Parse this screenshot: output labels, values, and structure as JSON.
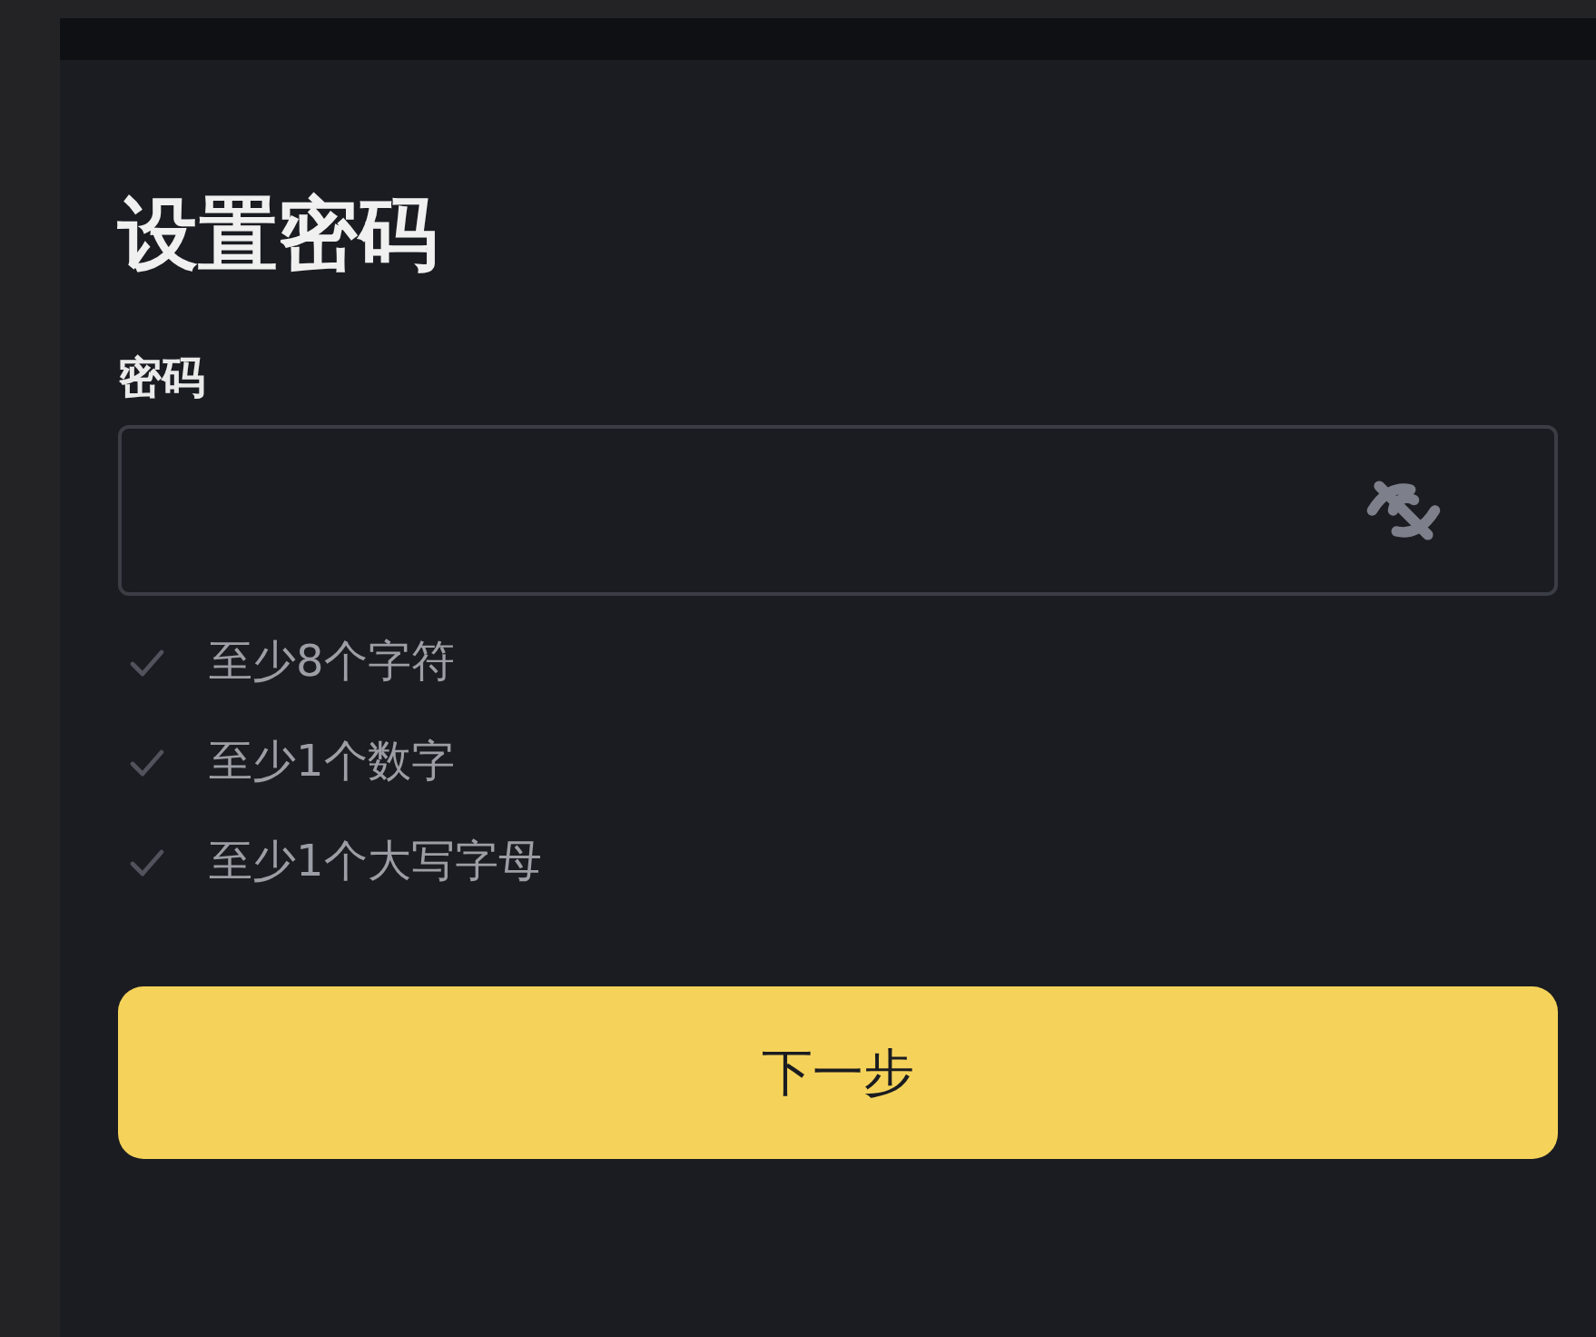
{
  "title": "设置密码",
  "password_field": {
    "label": "密码",
    "visible": false
  },
  "requirements": [
    {
      "text": "至少8个字符",
      "met": false
    },
    {
      "text": "至少1个数字",
      "met": false
    },
    {
      "text": "至少1个大写字母",
      "met": false
    }
  ],
  "next_button": {
    "label": "下一步"
  }
}
